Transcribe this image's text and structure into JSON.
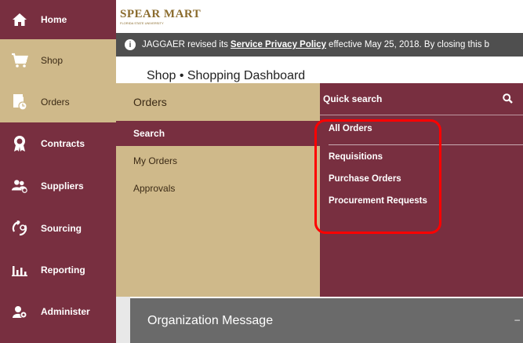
{
  "nav": {
    "items": [
      {
        "label": "Home",
        "icon": "home-icon"
      },
      {
        "label": "Shop",
        "icon": "cart-icon"
      },
      {
        "label": "Orders",
        "icon": "orders-icon"
      },
      {
        "label": "Contracts",
        "icon": "award-icon"
      },
      {
        "label": "Suppliers",
        "icon": "people-icon"
      },
      {
        "label": "Sourcing",
        "icon": "sourcing-icon"
      },
      {
        "label": "Reporting",
        "icon": "chart-icon"
      },
      {
        "label": "Administer",
        "icon": "gear-icon"
      }
    ]
  },
  "header": {
    "logo": "SPEAR MART",
    "logo_sub": "FLORIDA STATE UNIVERSITY"
  },
  "notice": {
    "text_before": "JAGGAER revised its",
    "link": "Service Privacy Policy",
    "text_after": "effective May 25, 2018. By closing this b"
  },
  "breadcrumb": "Shop  •  Shopping Dashboard",
  "flyout": {
    "title": "Orders",
    "items": [
      "Search",
      "My Orders",
      "Approvals"
    ],
    "quick_search_placeholder": "Quick search",
    "results": [
      "All Orders",
      "Requisitions",
      "Purchase Orders",
      "Procurement Requests"
    ]
  },
  "org_message": {
    "title": "Organization Message",
    "tail": "–"
  },
  "colors": {
    "garnet": "#782f40",
    "gold": "#cfb98a",
    "notice_bg": "#4f4f4f",
    "highlight": "#ff0000"
  }
}
